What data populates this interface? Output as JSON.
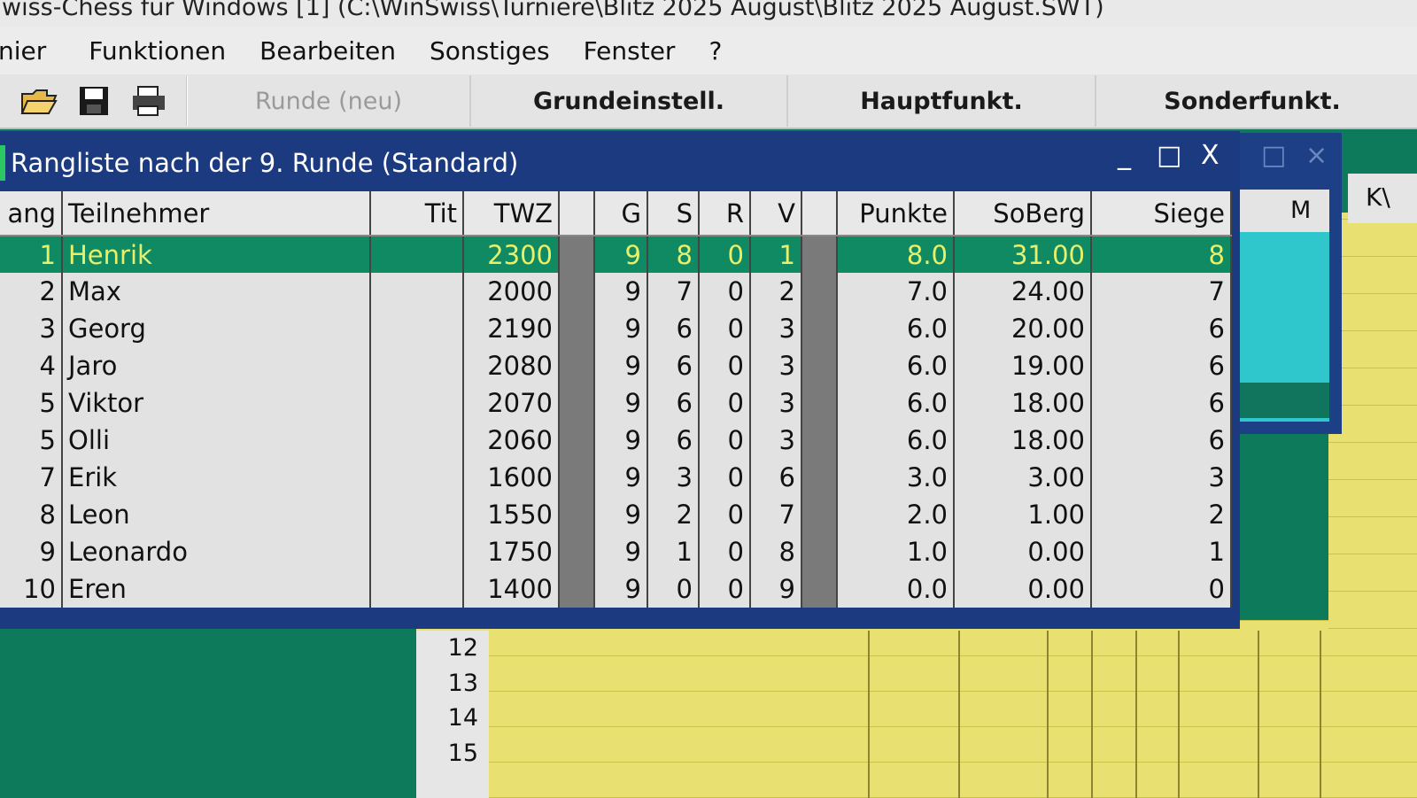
{
  "app": {
    "title": "wiss-Chess für Windows  [1]   (C:\\WinSwiss\\Turniere\\Blitz 2025 August\\Blitz 2025 August.SWT)"
  },
  "menu": [
    "nier",
    "Funktionen",
    "Bearbeiten",
    "Sonstiges",
    "Fenster",
    "?"
  ],
  "toolbar": {
    "icons": [
      "open-folder-icon",
      "save-icon",
      "print-icon"
    ],
    "buttons": [
      {
        "label": "Runde (neu)",
        "enabled": false
      },
      {
        "label": "Grundeinstell.",
        "enabled": true
      },
      {
        "label": "Hauptfunkt.",
        "enabled": true
      },
      {
        "label": "Sonderfunkt.",
        "enabled": true
      }
    ]
  },
  "rank_window": {
    "title": "Rangliste nach der 9. Runde (Standard)",
    "controls": {
      "minimize": "_",
      "maximize": "□",
      "close": "X"
    },
    "columns": [
      "ang",
      "Teilnehmer",
      "Tit",
      "TWZ",
      "",
      "G",
      "S",
      "R",
      "V",
      "",
      "Punkte",
      "SoBerg",
      "Siege"
    ],
    "rows": [
      {
        "rang": "1",
        "name": "Henrik",
        "tit": "",
        "twz": "2300",
        "g": "9",
        "s": "8",
        "r": "0",
        "v": "1",
        "punkte": "8.0",
        "soberg": "31.00",
        "siege": "8",
        "selected": true
      },
      {
        "rang": "2",
        "name": "Max",
        "tit": "",
        "twz": "2000",
        "g": "9",
        "s": "7",
        "r": "0",
        "v": "2",
        "punkte": "7.0",
        "soberg": "24.00",
        "siege": "7",
        "selected": false
      },
      {
        "rang": "3",
        "name": "Georg",
        "tit": "",
        "twz": "2190",
        "g": "9",
        "s": "6",
        "r": "0",
        "v": "3",
        "punkte": "6.0",
        "soberg": "20.00",
        "siege": "6",
        "selected": false
      },
      {
        "rang": "4",
        "name": "Jaro",
        "tit": "",
        "twz": "2080",
        "g": "9",
        "s": "6",
        "r": "0",
        "v": "3",
        "punkte": "6.0",
        "soberg": "19.00",
        "siege": "6",
        "selected": false
      },
      {
        "rang": "5",
        "name": "Viktor",
        "tit": "",
        "twz": "2070",
        "g": "9",
        "s": "6",
        "r": "0",
        "v": "3",
        "punkte": "6.0",
        "soberg": "18.00",
        "siege": "6",
        "selected": false
      },
      {
        "rang": "5",
        "name": "Olli",
        "tit": "",
        "twz": "2060",
        "g": "9",
        "s": "6",
        "r": "0",
        "v": "3",
        "punkte": "6.0",
        "soberg": "18.00",
        "siege": "6",
        "selected": false
      },
      {
        "rang": "7",
        "name": "Erik",
        "tit": "",
        "twz": "1600",
        "g": "9",
        "s": "3",
        "r": "0",
        "v": "6",
        "punkte": "3.0",
        "soberg": "3.00",
        "siege": "3",
        "selected": false
      },
      {
        "rang": "8",
        "name": "Leon",
        "tit": "",
        "twz": "1550",
        "g": "9",
        "s": "2",
        "r": "0",
        "v": "7",
        "punkte": "2.0",
        "soberg": "1.00",
        "siege": "2",
        "selected": false
      },
      {
        "rang": "9",
        "name": "Leonardo",
        "tit": "",
        "twz": "1750",
        "g": "9",
        "s": "1",
        "r": "0",
        "v": "8",
        "punkte": "1.0",
        "soberg": "0.00",
        "siege": "1",
        "selected": false
      },
      {
        "rang": "10",
        "name": "Eren",
        "tit": "",
        "twz": "1400",
        "g": "9",
        "s": "0",
        "r": "0",
        "v": "9",
        "punkte": "0.0",
        "soberg": "0.00",
        "siege": "0",
        "selected": false
      }
    ]
  },
  "background_window": {
    "header": "M",
    "side_header": "K\\"
  },
  "background_grid": {
    "row_numbers": [
      "12",
      "13",
      "14",
      "15"
    ]
  },
  "colors": {
    "desktop": "#0e7a5c",
    "window_frame": "#1b3a80",
    "selection": "#0f8a62",
    "selection_text": "#e8f06a",
    "grid_yellow": "#e8e070",
    "cyan": "#2fc7cc"
  }
}
